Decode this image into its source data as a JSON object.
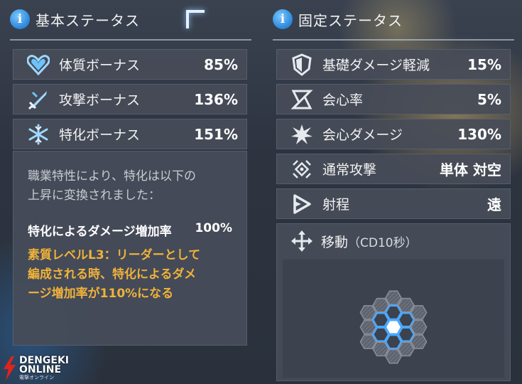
{
  "basic_status": {
    "title": "基本ステータス",
    "rows": [
      {
        "icon": "heart-icon",
        "label": "体質ボーナス",
        "value": "85%"
      },
      {
        "icon": "sword-icon",
        "label": "攻撃ボーナス",
        "value": "136%"
      },
      {
        "icon": "snowflake-icon",
        "label": "特化ボーナス",
        "value": "151%"
      }
    ],
    "popup": {
      "desc_line1": "職業特性により、特化は以下の",
      "desc_line2": "上昇に変換されました：",
      "bonus_label": "特化によるダメージ増加率",
      "bonus_value": "100%",
      "note_line1": "素質レベルL3：リーダーとして",
      "note_line2": "編成される時、特化によるダメ",
      "note_line3": "ージ増加率が110%になる"
    }
  },
  "fixed_status": {
    "title": "固定ステータス",
    "rows": [
      {
        "icon": "shield-icon",
        "label": "基礎ダメージ軽減",
        "value": "15%"
      },
      {
        "icon": "crit-rate-icon",
        "label": "会心率",
        "value": "5%"
      },
      {
        "icon": "burst-icon",
        "label": "会心ダメージ",
        "value": "130%"
      },
      {
        "icon": "normal-attack-icon",
        "label": "通常攻撃",
        "value": "単体 対空"
      },
      {
        "icon": "range-icon",
        "label": "射程",
        "value": "遠"
      }
    ],
    "move": {
      "icon": "move-arrows-icon",
      "label": "移動",
      "cd": "（CD10秒）"
    }
  },
  "watermark": {
    "line1": "DENGEKI",
    "line2": "ONLINE",
    "line3": "電撃オンライン"
  },
  "colors": {
    "accent_blue": "#2a86d8",
    "note_orange": "#f0b23a",
    "hex_highlight": "#4aa8ff"
  }
}
